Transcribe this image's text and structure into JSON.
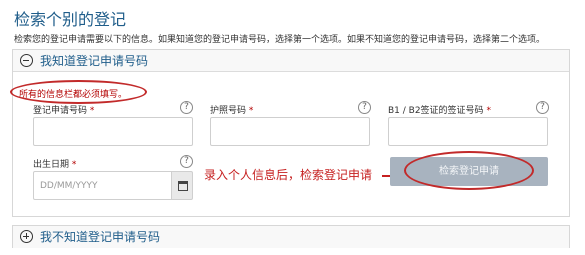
{
  "page": {
    "title": "检索个别的登记",
    "instructions": "检索您的登记申请需要以下的信息。如果知道您的登记申请号码，选择第一个选项。如果不知道您的登记申请号码，选择第二个选项。"
  },
  "known_panel": {
    "header": "我知道登记申请号码",
    "required_note": "所有的信息栏都必须填写。",
    "fields": {
      "registration_number": {
        "label": "登记申请号码",
        "required": "*",
        "value": ""
      },
      "passport_number": {
        "label": "护照号码",
        "required": "*",
        "value": ""
      },
      "visa_number": {
        "label": "B1 / B2签证的签证号码",
        "required": "*",
        "value": ""
      },
      "birth_date": {
        "label": "出生日期",
        "required": "*",
        "placeholder": "DD/MM/YYYY"
      }
    },
    "help_symbol": "?",
    "search_button": "检索登记申请"
  },
  "annotation": "录入个人信息后，检索登记申请",
  "unknown_panel": {
    "header": "我不知道登记申请号码"
  },
  "icons": [
    "collapse-minus-icon",
    "expand-plus-icon",
    "help-icon",
    "calendar-icon",
    "arrow-icon"
  ],
  "colors": {
    "title": "#1f5d8a",
    "required": "#b30000",
    "annotation": "#c62020",
    "button": "#a8b3bf"
  }
}
